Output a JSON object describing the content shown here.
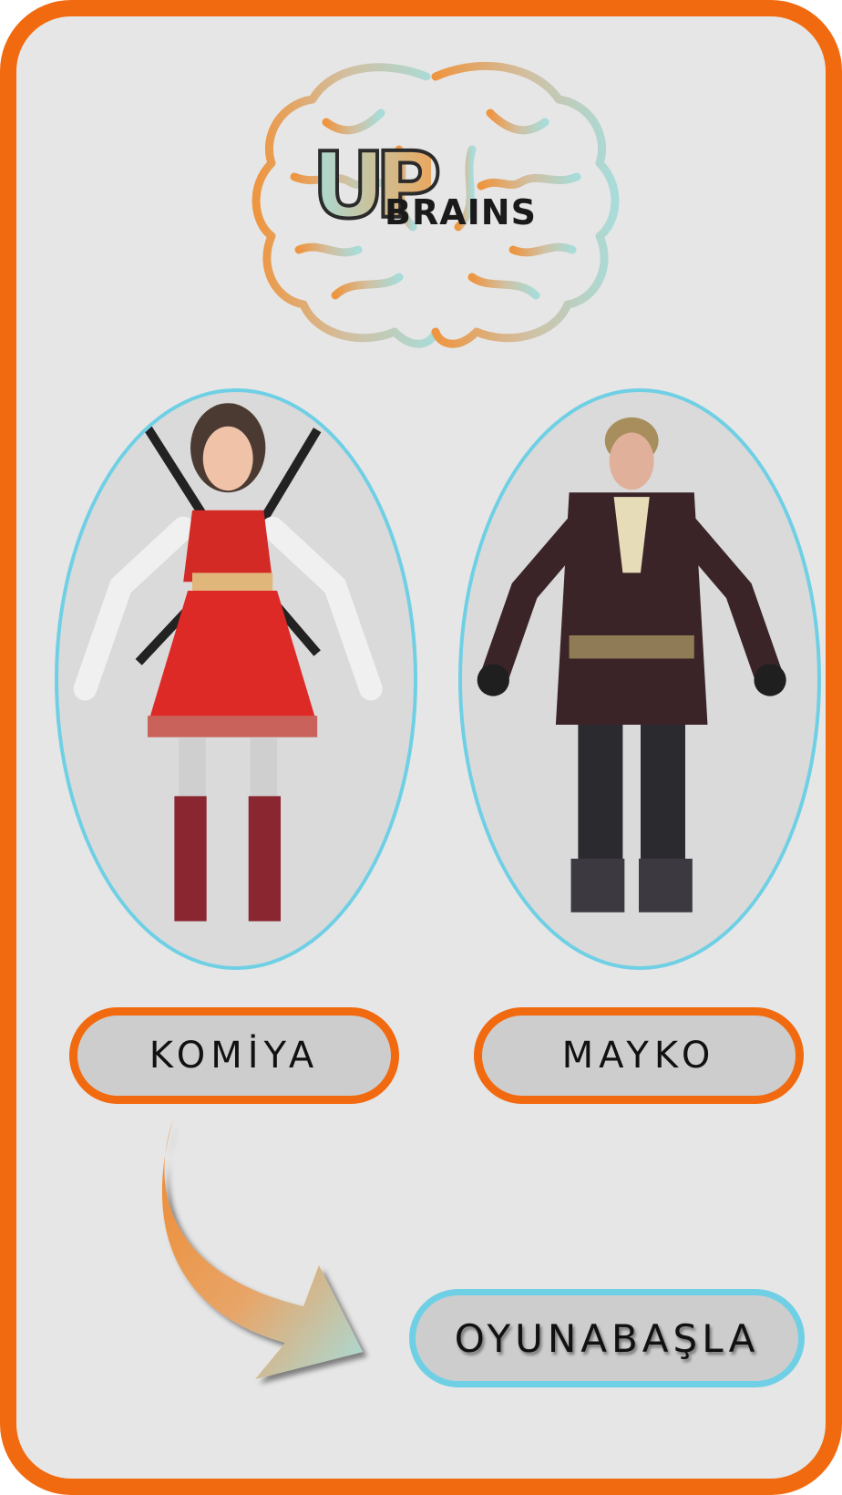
{
  "logo": {
    "mark": "UP",
    "name": "BRAINS",
    "icon": "brain-icon"
  },
  "characters": [
    {
      "name": "KOMİYA",
      "portrait": "female-samurai-character"
    },
    {
      "name": "MAYKO",
      "portrait": "male-adventurer-character"
    }
  ],
  "start_button": {
    "label": "OYUNABAŞLA"
  },
  "colors": {
    "frame": "#f26a0f",
    "background": "#e6e6e6",
    "accent_blue": "#6fd0e5",
    "button_fill": "#cdcdcd",
    "brain_orange": "#ee9540",
    "brain_teal": "#a8dcd9"
  }
}
